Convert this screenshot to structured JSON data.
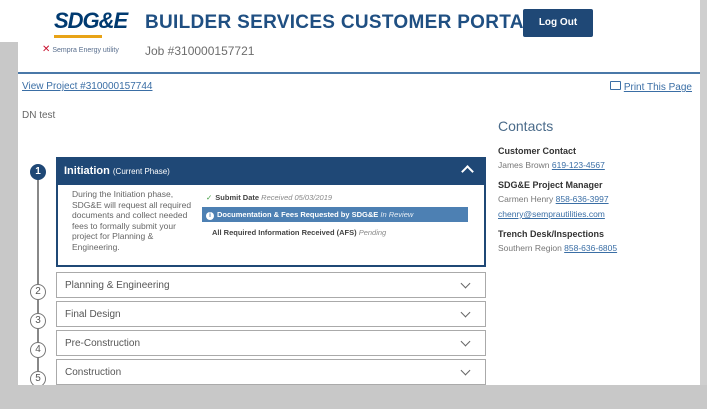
{
  "header": {
    "logo_text": "SDG&E",
    "logo_tagline": "Sempra Energy utility",
    "title": "BUILDER SERVICES CUSTOMER PORTAL",
    "job_number": "Job #310000157721",
    "logout_label": "Log Out"
  },
  "links": {
    "view_project": "View Project #310000157744",
    "print_page": "Print This Page"
  },
  "note": "DN test",
  "phases": [
    {
      "number": "1",
      "title": "Initiation",
      "status_label": "(Current Phase)",
      "active": true
    },
    {
      "number": "2",
      "title": "Planning & Engineering",
      "active": false
    },
    {
      "number": "3",
      "title": "Final Design",
      "active": false
    },
    {
      "number": "4",
      "title": "Pre-Construction",
      "active": false
    },
    {
      "number": "5",
      "title": "Construction",
      "active": false
    }
  ],
  "initiation": {
    "description": "During the Initiation phase, SDG&E will request all required documents and collect needed fees to formally submit your project for Planning & Engineering.",
    "statuses": [
      {
        "label": "Submit Date",
        "detail": "Received 05/03/2019",
        "state": "done"
      },
      {
        "label": "Documentation & Fees Requested by SDG&E",
        "detail": "In Review",
        "state": "current"
      },
      {
        "label": "All Required Information Received (AFS)",
        "detail": "Pending",
        "state": "pending"
      }
    ]
  },
  "contacts": {
    "heading": "Contacts",
    "customer_contact": {
      "role": "Customer Contact",
      "name": "James Brown",
      "phone": "619-123-4567"
    },
    "project_manager": {
      "role": "SDG&E Project Manager",
      "name": "Carmen Henry",
      "phone": "858-636-3997",
      "email": "chenry@semprautilities.com"
    },
    "trench_desk": {
      "role": "Trench Desk/Inspections",
      "region": "Southern Region",
      "phone": "858-636-6805"
    }
  },
  "colors": {
    "primary": "#1f4876",
    "highlight": "#4d80b3",
    "link": "#3a6ea5",
    "success": "#3c9a3c",
    "logo_accent": "#e8a317"
  }
}
